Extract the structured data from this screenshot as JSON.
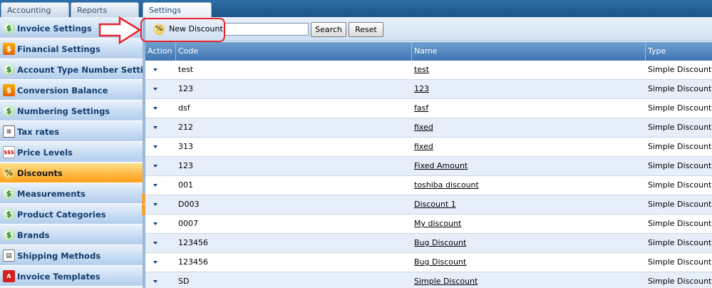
{
  "top_tabs": [
    {
      "label": "Accounting"
    },
    {
      "label": "Reports"
    },
    {
      "label": "Settings"
    }
  ],
  "sidebar": {
    "items": [
      {
        "label": "Invoice Settings",
        "icon": "dollar-settings-icon"
      },
      {
        "label": "Financial Settings",
        "icon": "dollar-arrows-icon"
      },
      {
        "label": "Account Type Number Settings",
        "icon": "dollar-settings-icon"
      },
      {
        "label": "Conversion Balance",
        "icon": "dollar-arrows-icon"
      },
      {
        "label": "Numbering Settings",
        "icon": "dollar-settings-icon"
      },
      {
        "label": "Tax rates",
        "icon": "list-icon"
      },
      {
        "label": "Price Levels",
        "icon": "price-tag-icon"
      },
      {
        "label": "Discounts",
        "icon": "percent-icon",
        "active": true
      },
      {
        "label": "Measurements",
        "icon": "dollar-settings-icon"
      },
      {
        "label": "Product Categories",
        "icon": "dollar-settings-icon"
      },
      {
        "label": "Brands",
        "icon": "dollar-settings-icon"
      },
      {
        "label": "Shipping Methods",
        "icon": "document-icon"
      },
      {
        "label": "Invoice Templates",
        "icon": "pdf-icon"
      }
    ]
  },
  "toolbar": {
    "new_label": "New Discount",
    "search_value": "",
    "search_button": "Search",
    "reset_button": "Reset"
  },
  "grid": {
    "columns": [
      "Action",
      "Code",
      "Name",
      "Type"
    ],
    "rows": [
      {
        "code": "test",
        "name": "test",
        "type": "Simple Discount"
      },
      {
        "code": "123",
        "name": "123",
        "type": "Simple Discount"
      },
      {
        "code": "dsf",
        "name": "fasf",
        "type": "Simple Discount"
      },
      {
        "code": "212",
        "name": "fixed",
        "type": "Simple Discount"
      },
      {
        "code": "313",
        "name": "fixed",
        "type": "Simple Discount"
      },
      {
        "code": "123",
        "name": "Fixed Amount",
        "type": "Simple Discount"
      },
      {
        "code": "001",
        "name": "toshiba discount",
        "type": "Simple Discount"
      },
      {
        "code": "D003",
        "name": "Discount 1",
        "type": "Simple Discount"
      },
      {
        "code": "0007",
        "name": "My discount",
        "type": "Simple Discount"
      },
      {
        "code": "123456",
        "name": "Bug Discount",
        "type": "Simple Discount"
      },
      {
        "code": "123456",
        "name": "Bug Discount",
        "type": "Simple Discount"
      },
      {
        "code": "SD",
        "name": "Simple Discount",
        "type": "Simple Discount"
      }
    ]
  },
  "colors": {
    "highlight": "#e8242b",
    "active_item": "#ffb945",
    "header": "#3f75b2"
  }
}
